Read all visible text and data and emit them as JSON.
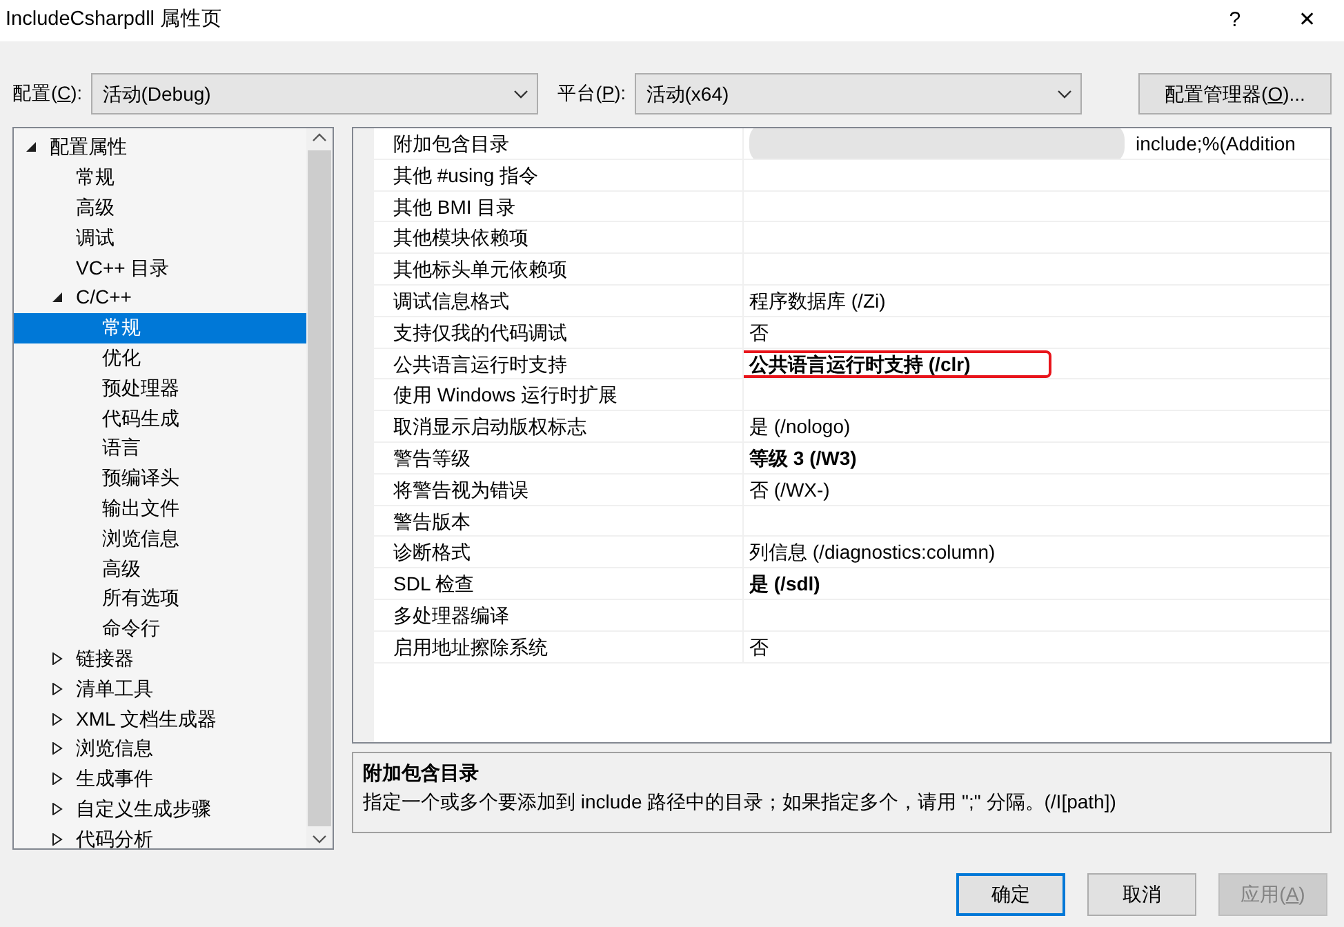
{
  "window": {
    "title": "IncludeCsharpdll 属性页",
    "help": "?",
    "close": "✕"
  },
  "toolbar": {
    "configuration": {
      "label_before": "配置(",
      "access_key": "C",
      "label_after": "):",
      "value": "活动(Debug)"
    },
    "platform": {
      "label_before": "平台(",
      "access_key": "P",
      "label_after": "):",
      "value": "活动(x64)"
    },
    "manager_button": {
      "label_before": "配置管理器(",
      "access_key": "O",
      "label_after": ")..."
    }
  },
  "tree": [
    {
      "label": "配置属性",
      "expanded": true,
      "selected": false,
      "children": [
        {
          "label": "常规",
          "selected": false
        },
        {
          "label": "高级",
          "selected": false
        },
        {
          "label": "调试",
          "selected": false
        },
        {
          "label": "VC++ 目录",
          "selected": false
        },
        {
          "label": "C/C++",
          "expanded": true,
          "selected": false,
          "children": [
            {
              "label": "常规",
              "selected": true
            },
            {
              "label": "优化",
              "selected": false
            },
            {
              "label": "预处理器",
              "selected": false
            },
            {
              "label": "代码生成",
              "selected": false
            },
            {
              "label": "语言",
              "selected": false
            },
            {
              "label": "预编译头",
              "selected": false
            },
            {
              "label": "输出文件",
              "selected": false
            },
            {
              "label": "浏览信息",
              "selected": false
            },
            {
              "label": "高级",
              "selected": false
            },
            {
              "label": "所有选项",
              "selected": false
            },
            {
              "label": "命令行",
              "selected": false
            }
          ]
        },
        {
          "label": "链接器",
          "expanded": false,
          "selected": false
        },
        {
          "label": "清单工具",
          "expanded": false,
          "selected": false
        },
        {
          "label": "XML 文档生成器",
          "expanded": false,
          "selected": false
        },
        {
          "label": "浏览信息",
          "expanded": false,
          "selected": false
        },
        {
          "label": "生成事件",
          "expanded": false,
          "selected": false
        },
        {
          "label": "自定义生成步骤",
          "expanded": false,
          "selected": false
        },
        {
          "label": "代码分析",
          "expanded": false,
          "selected": false
        }
      ]
    }
  ],
  "properties": [
    {
      "name": "附加包含目录",
      "value": "include;%(Addition",
      "redacted": true,
      "bold": false,
      "highlighted": false
    },
    {
      "name": "其他 #using 指令",
      "redacted": false,
      "highlighted": false
    },
    {
      "name": "其他 BMI 目录",
      "redacted": false,
      "highlighted": false
    },
    {
      "name": "其他模块依赖项",
      "redacted": false,
      "highlighted": false
    },
    {
      "name": "其他标头单元依赖项",
      "redacted": false,
      "highlighted": false
    },
    {
      "name": "调试信息格式",
      "value": "程序数据库 (/Zi)",
      "redacted": false,
      "bold": false,
      "highlighted": false
    },
    {
      "name": "支持仅我的代码调试",
      "value": "否",
      "redacted": false,
      "bold": false,
      "highlighted": false
    },
    {
      "name": "公共语言运行时支持",
      "value": "公共语言运行时支持 (/clr)",
      "redacted": false,
      "bold": true,
      "highlighted": true
    },
    {
      "name": "使用 Windows 运行时扩展",
      "redacted": false,
      "highlighted": false
    },
    {
      "name": "取消显示启动版权标志",
      "value": "是 (/nologo)",
      "redacted": false,
      "bold": false,
      "highlighted": false
    },
    {
      "name": "警告等级",
      "value": "等级 3 (/W3)",
      "redacted": false,
      "bold": true,
      "highlighted": false
    },
    {
      "name": "将警告视为错误",
      "value": "否 (/WX-)",
      "redacted": false,
      "bold": false,
      "highlighted": false
    },
    {
      "name": "警告版本",
      "redacted": false,
      "highlighted": false
    },
    {
      "name": "诊断格式",
      "value": "列信息 (/diagnostics:column)",
      "redacted": false,
      "bold": false,
      "highlighted": false
    },
    {
      "name": "SDL 检查",
      "value": "是 (/sdl)",
      "redacted": false,
      "bold": true,
      "highlighted": false
    },
    {
      "name": "多处理器编译",
      "redacted": false,
      "highlighted": false
    },
    {
      "name": "启用地址擦除系统",
      "value": "否",
      "redacted": false,
      "bold": false,
      "highlighted": false
    }
  ],
  "description": {
    "title": "附加包含目录",
    "text": "指定一个或多个要添加到 include 路径中的目录；如果指定多个，请用 \";\" 分隔。(/I[path])"
  },
  "buttons": [
    {
      "label_before": "确定",
      "default": true,
      "disabled": false
    },
    {
      "label_before": "取消",
      "default": false,
      "disabled": false
    },
    {
      "label_before": "应用(",
      "access_key": "A",
      "label_after": ")",
      "default": false,
      "disabled": true
    }
  ]
}
